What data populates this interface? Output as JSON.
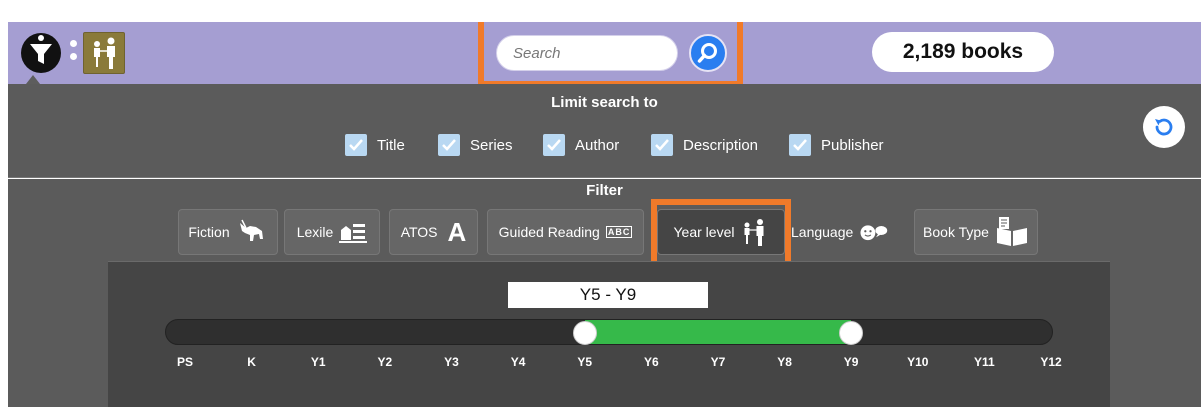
{
  "search": {
    "placeholder": "Search"
  },
  "book_count": "2,189 books",
  "limit": {
    "title": "Limit search to",
    "options": [
      {
        "label": "Title",
        "checked": true
      },
      {
        "label": "Series",
        "checked": true
      },
      {
        "label": "Author",
        "checked": true
      },
      {
        "label": "Description",
        "checked": true
      },
      {
        "label": "Publisher",
        "checked": true
      }
    ]
  },
  "filter": {
    "title": "Filter",
    "buttons": [
      {
        "label": "Fiction",
        "icon": "unicorn-icon"
      },
      {
        "label": "Lexile",
        "icon": "books-icon"
      },
      {
        "label": "ATOS",
        "icon": "letter-a-icon",
        "glyph": "A"
      },
      {
        "label": "Guided Reading",
        "icon": "abc-blocks-icon",
        "glyph": "ABC"
      },
      {
        "label": "Year level",
        "icon": "parent-child-icon",
        "active": true
      },
      {
        "label": "Language",
        "icon": "speech-face-icon"
      },
      {
        "label": "Book Type",
        "icon": "open-book-icon"
      }
    ]
  },
  "year_slider": {
    "range_label": "Y5 - Y9",
    "ticks": [
      "PS",
      "K",
      "Y1",
      "Y2",
      "Y3",
      "Y4",
      "Y5",
      "Y6",
      "Y7",
      "Y8",
      "Y9",
      "Y10",
      "Y11",
      "Y12"
    ],
    "selected_from": "Y5",
    "selected_to": "Y9"
  },
  "colors": {
    "topbar": "#a59ed2",
    "highlight": "#f07a2a",
    "search_button": "#2a7ef0",
    "range_fill": "#36b94a",
    "panel": "#5b5b5b"
  }
}
